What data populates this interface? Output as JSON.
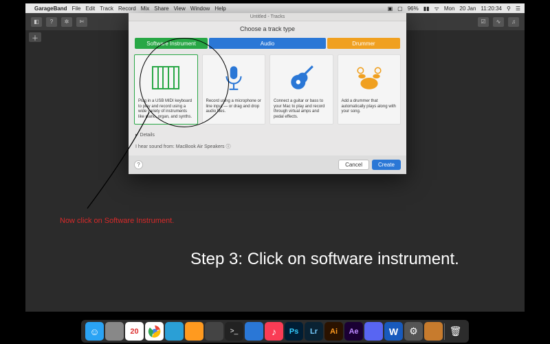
{
  "menubar": {
    "app": "GarageBand",
    "items": [
      "File",
      "Edit",
      "Track",
      "Record",
      "Mix",
      "Share",
      "View",
      "Window",
      "Help"
    ],
    "right": {
      "battery": "96%",
      "day": "Mon",
      "date": "20 Jan",
      "time": "11:20:34"
    }
  },
  "window_title": "Untitled - Tracks",
  "modal": {
    "header": "Choose a track type",
    "tabs": {
      "software": "Software Instrument",
      "audio": "Audio",
      "drummer": "Drummer"
    },
    "cards": [
      {
        "id": "software",
        "desc": "Plug in a USB MIDI keyboard to play and record using a wide variety of instruments like piano, organ, and synths."
      },
      {
        "id": "audio-mic",
        "desc": "Record using a microphone or line input — or drag and drop audio files."
      },
      {
        "id": "audio-guitar",
        "desc": "Connect a guitar or bass to your Mac to play and record through virtual amps and pedal effects."
      },
      {
        "id": "drummer",
        "desc": "Add a drummer that automatically plays along with your song."
      }
    ],
    "details_label": "Details",
    "sound_row": "I hear sound from: MacBook Air Speakers",
    "cancel": "Cancel",
    "create": "Create"
  },
  "annotations": {
    "red_note": "Now click on Software Instrument.",
    "step_overlay": "Step 3: Click on software instrument."
  },
  "dock": [
    {
      "name": "finder",
      "bg": "#2aa3f4"
    },
    {
      "name": "launchpad",
      "bg": "#888"
    },
    {
      "name": "calendar",
      "bg": "#fff"
    },
    {
      "name": "chrome",
      "bg": "#fff"
    },
    {
      "name": "safari",
      "bg": "#2a9fd6"
    },
    {
      "name": "pages",
      "bg": "#ff9a1f"
    },
    {
      "name": "sublime",
      "bg": "#444"
    },
    {
      "name": "terminal",
      "bg": "#222"
    },
    {
      "name": "vscode",
      "bg": "#2a77d6"
    },
    {
      "name": "music",
      "bg": "#fa3c55"
    },
    {
      "name": "photoshop",
      "bg": "#001d34"
    },
    {
      "name": "lightroom",
      "bg": "#0a2233"
    },
    {
      "name": "illustrator",
      "bg": "#2a1200"
    },
    {
      "name": "aftereffects",
      "bg": "#1a0033"
    },
    {
      "name": "discord",
      "bg": "#5865f2"
    },
    {
      "name": "word",
      "bg": "#185abd"
    },
    {
      "name": "settings",
      "bg": "#555"
    },
    {
      "name": "garageband",
      "bg": "#c77b2d"
    },
    {
      "name": "trash",
      "bg": "#888"
    }
  ],
  "calendar_day": "20"
}
